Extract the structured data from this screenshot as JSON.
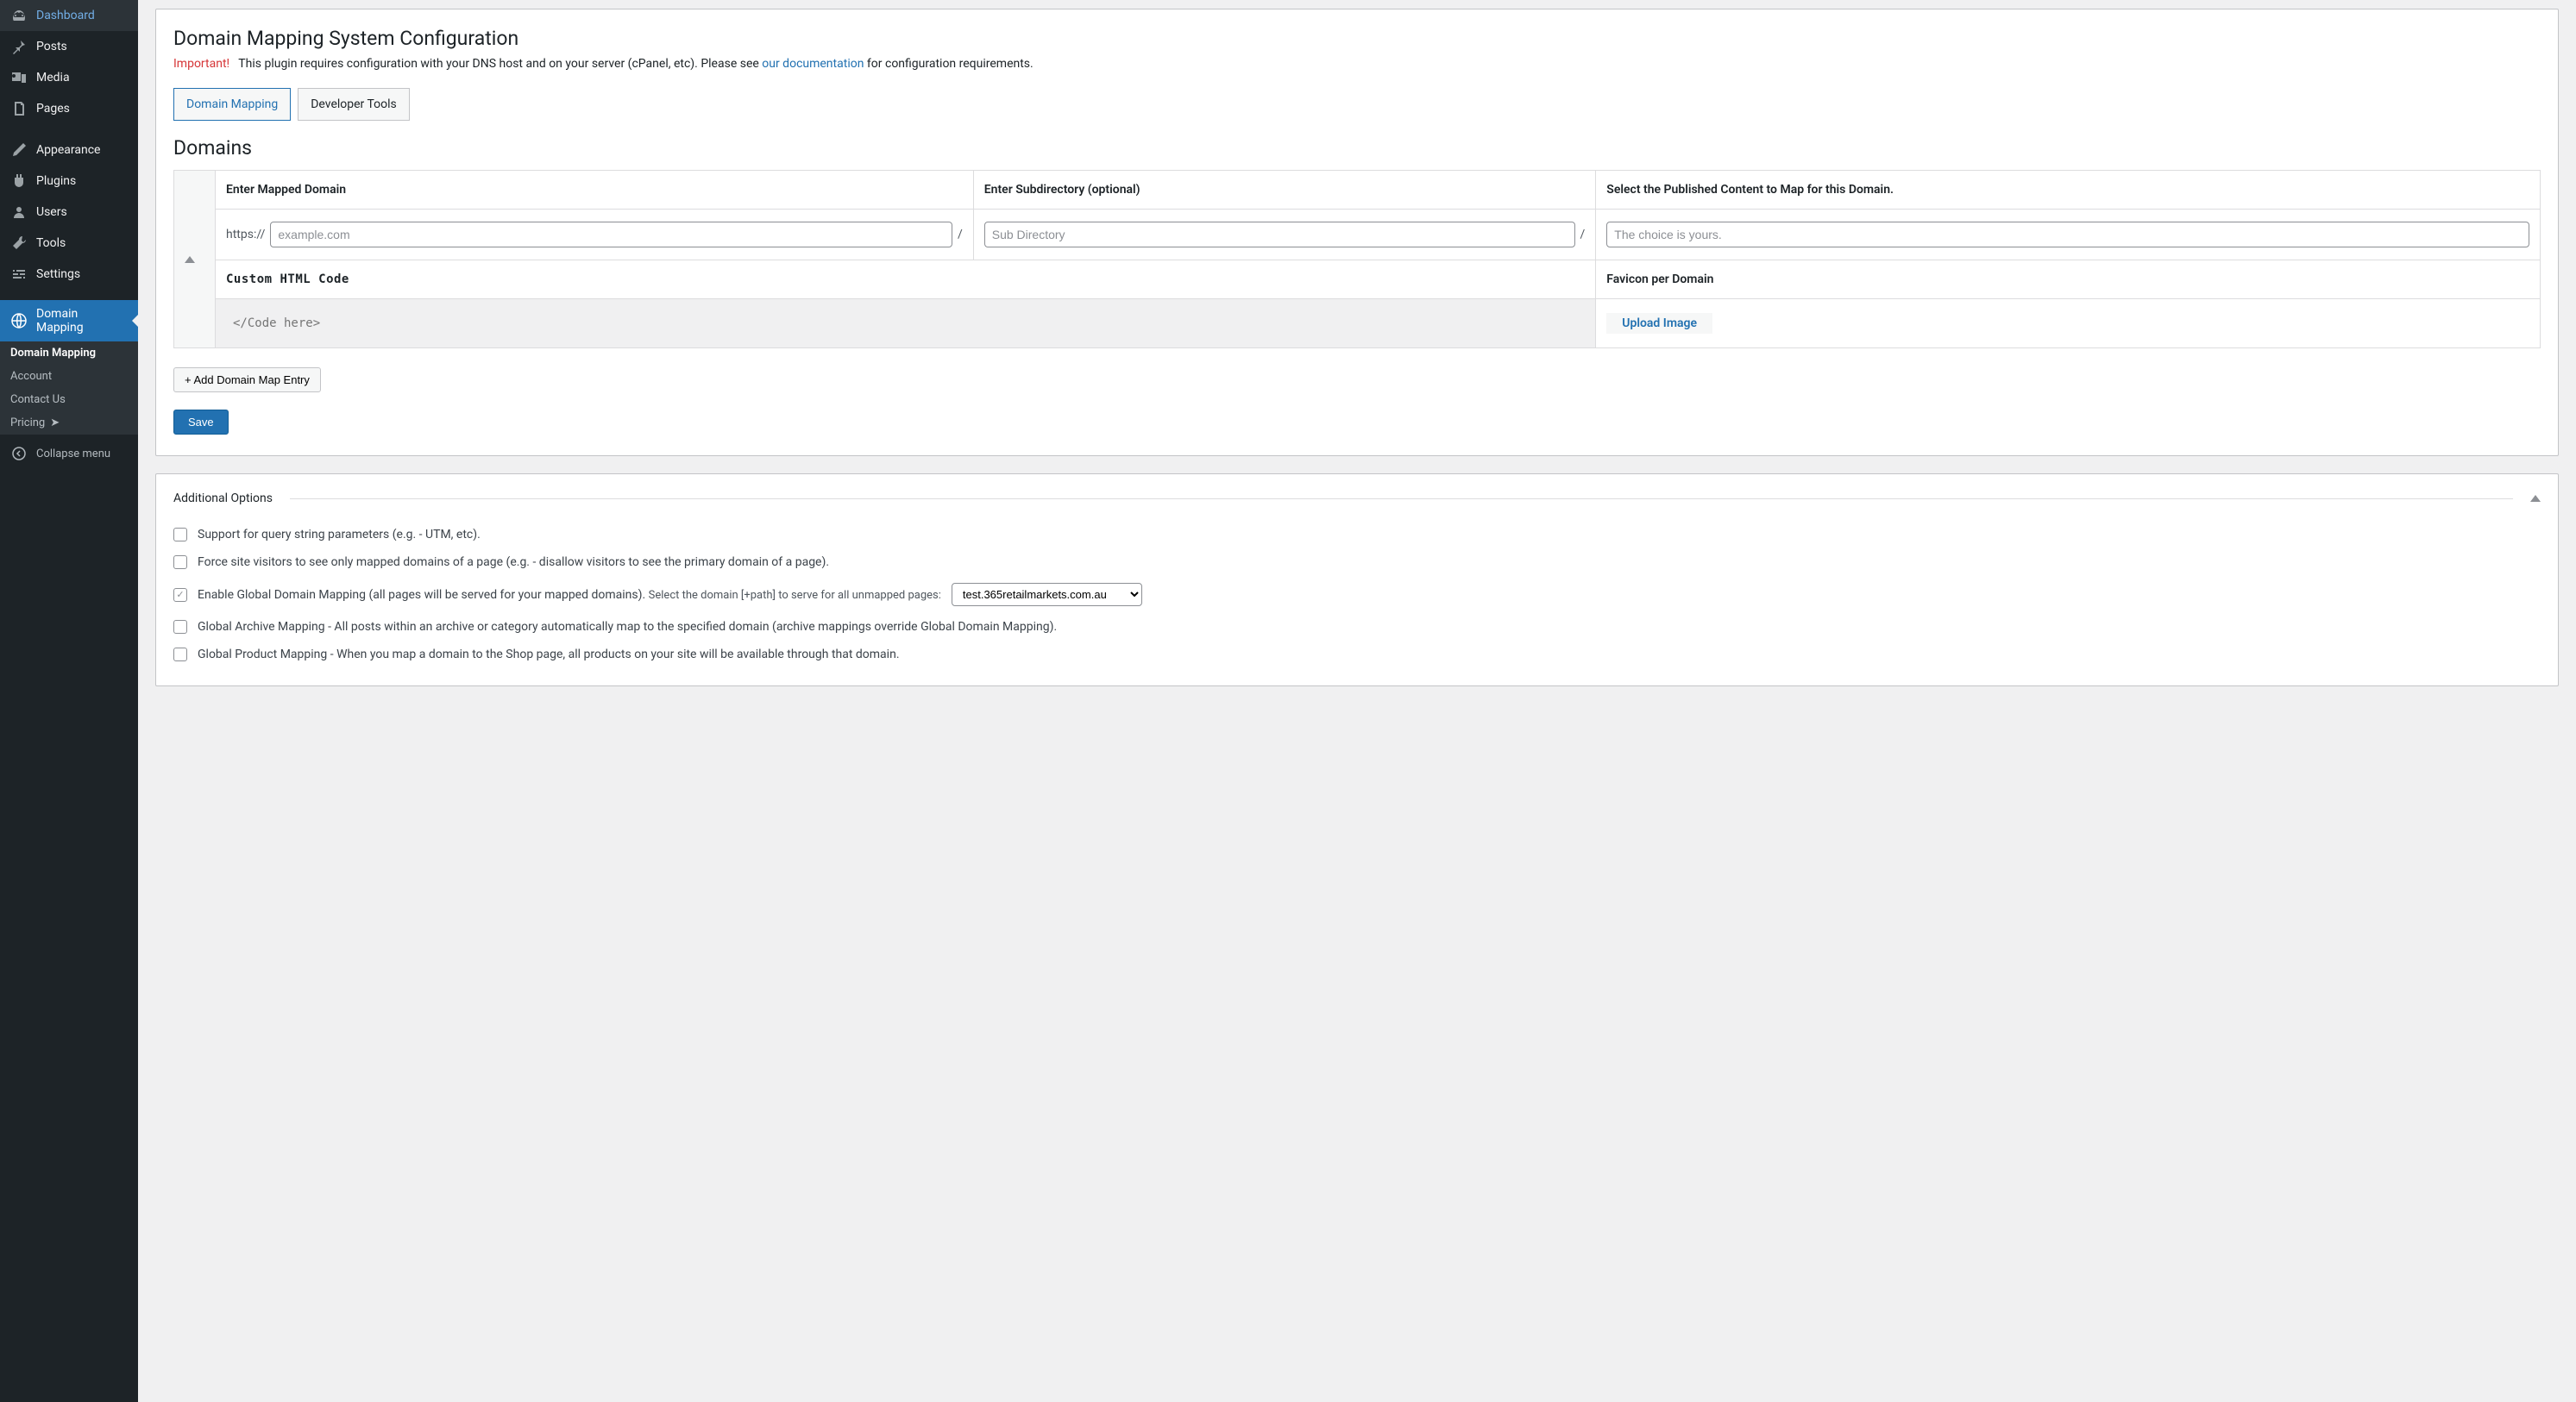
{
  "sidebar": {
    "items": [
      {
        "label": "Dashboard"
      },
      {
        "label": "Posts"
      },
      {
        "label": "Media"
      },
      {
        "label": "Pages"
      },
      {
        "label": "Appearance"
      },
      {
        "label": "Plugins"
      },
      {
        "label": "Users"
      },
      {
        "label": "Tools"
      },
      {
        "label": "Settings"
      },
      {
        "label": "Domain Mapping"
      }
    ],
    "submenu": [
      {
        "label": "Domain Mapping"
      },
      {
        "label": "Account"
      },
      {
        "label": "Contact Us"
      },
      {
        "label": "Pricing"
      }
    ],
    "collapse_label": "Collapse menu"
  },
  "header": {
    "title": "Domain Mapping System Configuration",
    "important_label": "Important!",
    "notice_text_before": "This plugin requires configuration with your DNS host and on your server (cPanel, etc). Please see ",
    "doc_link_text": "our documentation",
    "notice_text_after": " for configuration requirements."
  },
  "tabs": {
    "active": "Domain Mapping",
    "inactive": "Developer Tools"
  },
  "domains": {
    "section_title": "Domains",
    "col_domain": "Enter Mapped Domain",
    "col_subdir": "Enter Subdirectory (optional)",
    "col_content": "Select the Published Content to Map for this Domain.",
    "protocol": "https://",
    "slash": "/",
    "domain_placeholder": "example.com",
    "subdir_placeholder": "Sub Directory",
    "content_placeholder": "The choice is yours.",
    "custom_html_label": "Custom HTML Code",
    "favicon_label": "Favicon per Domain",
    "code_placeholder": "</Code here>",
    "upload_label": "Upload Image",
    "add_entry_label": "+ Add Domain Map Entry",
    "save_label": "Save"
  },
  "options": {
    "title": "Additional Options",
    "opt1": "Support for query string parameters (e.g. - UTM, etc).",
    "opt2": "Force site visitors to see only mapped domains of a page (e.g. - disallow visitors to see the primary domain of a page).",
    "opt3_main": "Enable Global Domain Mapping (all pages will be served for your mapped domains). ",
    "opt3_sub": "Select the domain [+path] to serve for all unmapped pages:",
    "opt3_select": "test.365retailmarkets.com.au",
    "opt4": "Global Archive Mapping - All posts within an archive or category automatically map to the specified domain (archive mappings override Global Domain Mapping).",
    "opt5": "Global Product Mapping - When you map a domain to the Shop page, all products on your site will be available through that domain."
  }
}
